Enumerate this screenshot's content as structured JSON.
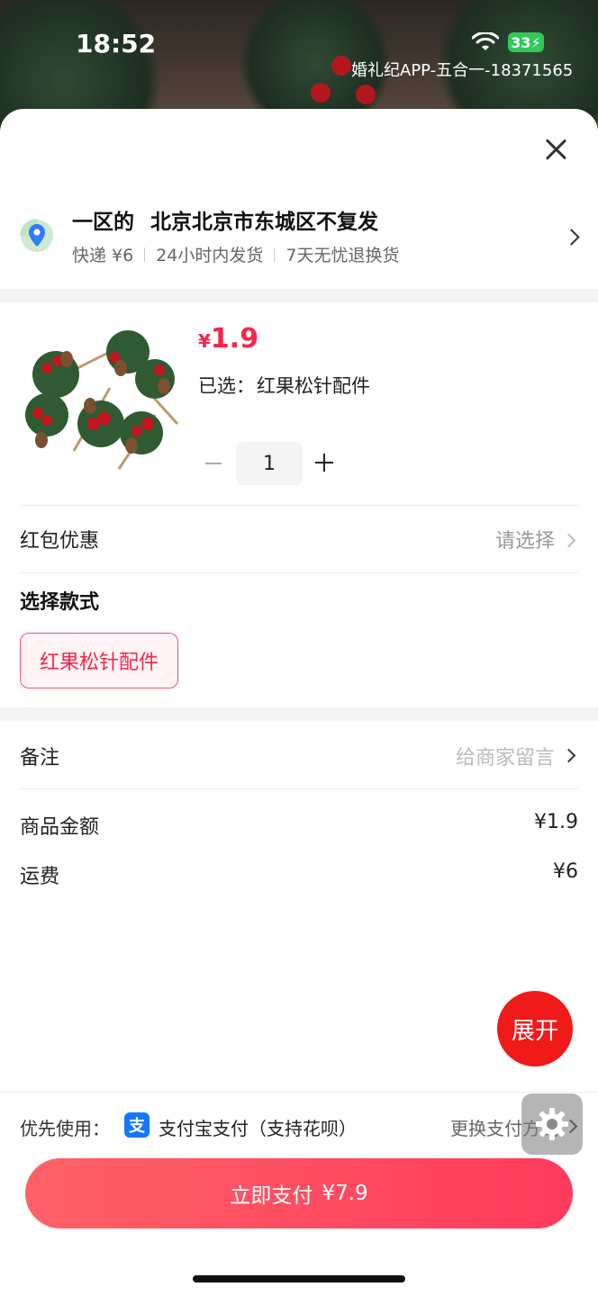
{
  "status_bar": {
    "time": "18:52",
    "battery": "33"
  },
  "watermark": "婚礼纪APP-五合一-18371565",
  "address": {
    "name": "一区的",
    "location": "北京北京市东城区不复发",
    "shipping": "快递 ¥6",
    "dispatch": "24小时内发货",
    "returns": "7天无忧退换货"
  },
  "product": {
    "price_symbol": "¥",
    "price": "1.9",
    "selected_label": "已选：",
    "selected_value": "红果松针配件",
    "quantity": "1"
  },
  "coupon": {
    "label": "红包优惠",
    "value": "请选择"
  },
  "style_section": {
    "title": "选择款式",
    "options": [
      "红果松针配件"
    ]
  },
  "note": {
    "label": "备注",
    "placeholder": "给商家留言"
  },
  "summary": {
    "goods_label": "商品金额",
    "goods_value": "¥1.9",
    "shipping_label": "运费",
    "shipping_value": "¥6"
  },
  "expand_button": "展开",
  "payment": {
    "prefer_label": "优先使用：",
    "method": "支付宝支付（支持花呗）",
    "change": "更换支付方式",
    "pay_label": "立即支付",
    "pay_amount": "¥7.9"
  },
  "colors": {
    "accent": "#f5264a",
    "pay_button": "#ff4760",
    "alipay": "#1677ff"
  }
}
